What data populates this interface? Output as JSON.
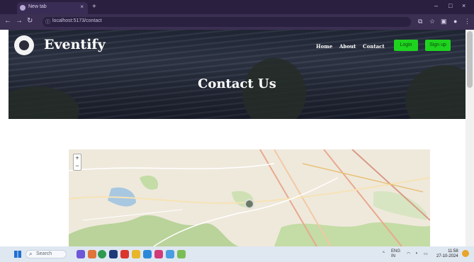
{
  "browser": {
    "tab_title": "New tab",
    "tab_close": "×",
    "new_tab": "+",
    "url": "localhost:5173/contact",
    "window_controls": [
      "–",
      "□",
      "×"
    ]
  },
  "site": {
    "brand": "Eventify",
    "nav": [
      "Home",
      "About",
      "Contact"
    ],
    "buttons": [
      "Login",
      "Sign up"
    ],
    "accent_color": "#1ed31e",
    "page_title": "Contact Us"
  },
  "map": {
    "zoom_in": "+",
    "zoom_out": "−"
  },
  "taskbar": {
    "search_placeholder": "Search",
    "clock_time": "11:58",
    "clock_date": "27-10-2024",
    "tray_lang": "ENG",
    "tray_region": "IN"
  }
}
